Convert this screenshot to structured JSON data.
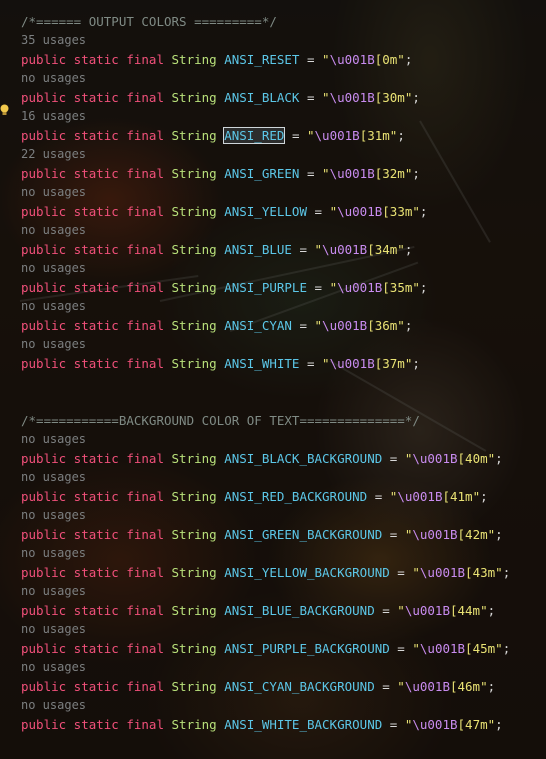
{
  "editor": {
    "header_comment_1": "/*====== OUTPUT COLORS =========*/",
    "header_comment_2": "/*===========BACKGROUND COLOR OF TEXT==============*/",
    "keywords": "public static final",
    "type": "String",
    "lightbulb_icon": "lightbulb-icon",
    "colors": {
      "keyword": "#f0507a",
      "type": "#b8e07a",
      "identifier": "#5cc7e8",
      "string": "#e9e274",
      "escape": "#c98cf0",
      "comment": "#7f8a84"
    },
    "lines": [
      {
        "usages": "35 usages",
        "name": "ANSI_RESET",
        "code": "0m"
      },
      {
        "usages": "no usages",
        "name": "ANSI_BLACK",
        "code": "30m"
      },
      {
        "usages": "16 usages",
        "name": "ANSI_RED",
        "code": "31m"
      },
      {
        "usages": "22 usages",
        "name": "ANSI_GREEN",
        "code": "32m"
      },
      {
        "usages": "no usages",
        "name": "ANSI_YELLOW",
        "code": "33m"
      },
      {
        "usages": "no usages",
        "name": "ANSI_BLUE",
        "code": "34m"
      },
      {
        "usages": "no usages",
        "name": "ANSI_PURPLE",
        "code": "35m"
      },
      {
        "usages": "no usages",
        "name": "ANSI_CYAN",
        "code": "36m"
      },
      {
        "usages": "no usages",
        "name": "ANSI_WHITE",
        "code": "37m"
      }
    ],
    "bg_lines": [
      {
        "usages": "no usages",
        "name": "ANSI_BLACK_BACKGROUND",
        "code": "40m"
      },
      {
        "usages": "no usages",
        "name": "ANSI_RED_BACKGROUND",
        "code": "41m"
      },
      {
        "usages": "no usages",
        "name": "ANSI_GREEN_BACKGROUND",
        "code": "42m"
      },
      {
        "usages": "no usages",
        "name": "ANSI_YELLOW_BACKGROUND",
        "code": "43m"
      },
      {
        "usages": "no usages",
        "name": "ANSI_BLUE_BACKGROUND",
        "code": "44m"
      },
      {
        "usages": "no usages",
        "name": "ANSI_PURPLE_BACKGROUND",
        "code": "45m"
      },
      {
        "usages": "no usages",
        "name": "ANSI_CYAN_BACKGROUND",
        "code": "46m"
      },
      {
        "usages": "no usages",
        "name": "ANSI_WHITE_BACKGROUND",
        "code": "47m"
      }
    ],
    "escape_prefix": "\\u001B",
    "selected_identifier": "ANSI_RED"
  }
}
